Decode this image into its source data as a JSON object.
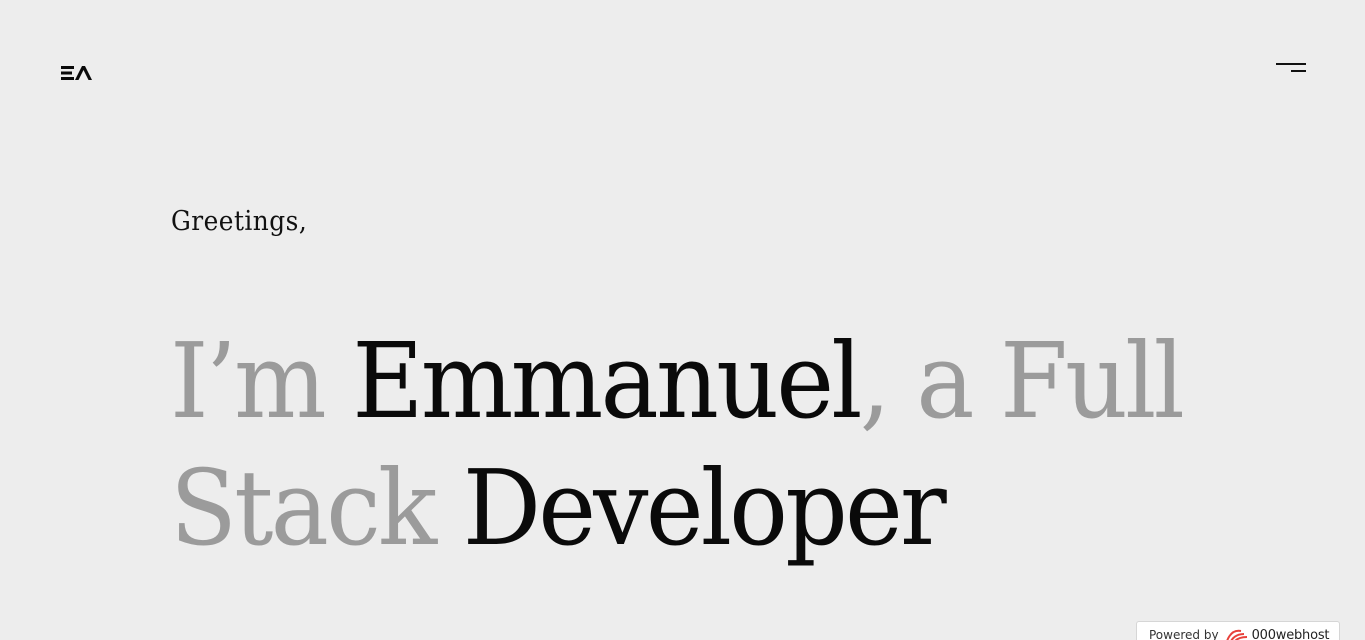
{
  "header": {
    "logo_icon": "ea-monogram-logo",
    "menu_icon": "hamburger-menu-icon"
  },
  "hero": {
    "greeting": "Greetings,",
    "line1": {
      "im": "I’m ",
      "name": "Emmanuel",
      "rest": ", a Full"
    },
    "line2": {
      "stack": "Stack ",
      "role": "Developer"
    },
    "colors": {
      "muted": "#9b9b9b",
      "strong": "#0a0a0a",
      "background": "#ededed"
    }
  },
  "badge": {
    "powered_by": "Powered by",
    "host_name": "000webhost",
    "host_icon": "000webhost-swirl-icon",
    "accent": "#e8413b"
  }
}
